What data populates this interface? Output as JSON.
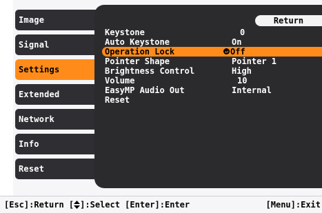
{
  "sidebar": {
    "items": [
      {
        "label": "Image"
      },
      {
        "label": "Signal"
      },
      {
        "label": "Settings"
      },
      {
        "label": "Extended"
      },
      {
        "label": "Network"
      },
      {
        "label": "Info"
      },
      {
        "label": "Reset"
      }
    ]
  },
  "panel": {
    "return_label": "Return",
    "rows": [
      {
        "label": "Keystone",
        "value": "0"
      },
      {
        "label": "Auto Keystone",
        "value": "On"
      },
      {
        "label": "Operation Lock",
        "value": "Off"
      },
      {
        "label": "Pointer Shape",
        "value": "Pointer 1"
      },
      {
        "label": "Brightness Control",
        "value": "High"
      },
      {
        "label": "Volume",
        "value": "10"
      },
      {
        "label": "EasyMP Audio Out",
        "value": "Internal"
      },
      {
        "label": "Reset",
        "value": ""
      }
    ]
  },
  "footer": {
    "part1": "[Esc]:Return [",
    "part2": "]:Select [Enter]:Enter",
    "right": "[Menu]:Exit"
  },
  "colors": {
    "accent": "#ff8c1a",
    "panel_bg": "#2b2b2e",
    "item_bg": "#2f2f33"
  },
  "icons": {
    "enter": "enter-return-icon",
    "select": "up-down-arrow-icon"
  }
}
